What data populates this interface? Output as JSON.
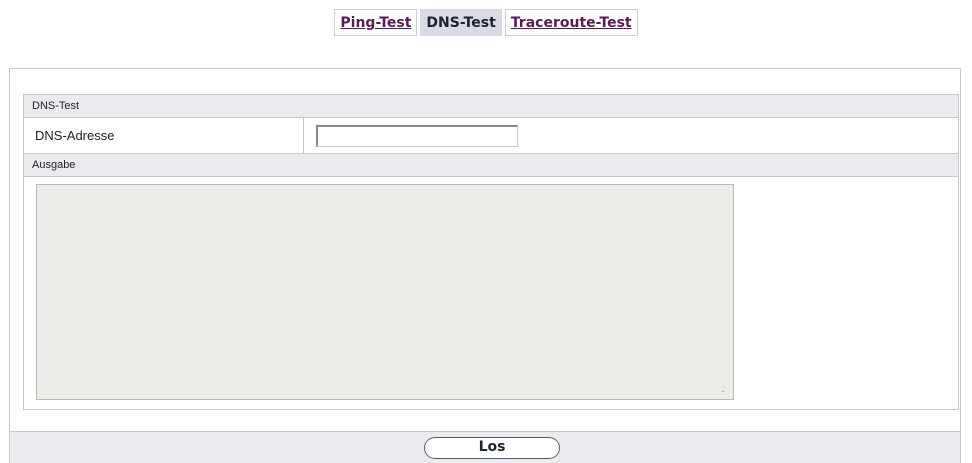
{
  "tabs": [
    {
      "label": "Ping-Test",
      "active": false
    },
    {
      "label": "DNS-Test",
      "active": true
    },
    {
      "label": "Traceroute-Test",
      "active": false
    }
  ],
  "dns_test": {
    "section_title": "DNS-Test",
    "address_label": "DNS-Adresse",
    "address_value": ""
  },
  "output": {
    "section_title": "Ausgabe",
    "content": ""
  },
  "footer": {
    "go_label": "Los"
  },
  "colors": {
    "link_text": "#5a1a57",
    "active_tab_bg": "#d7dbe4",
    "header_bg": "#eaebee",
    "output_bg": "#ecebe5"
  }
}
